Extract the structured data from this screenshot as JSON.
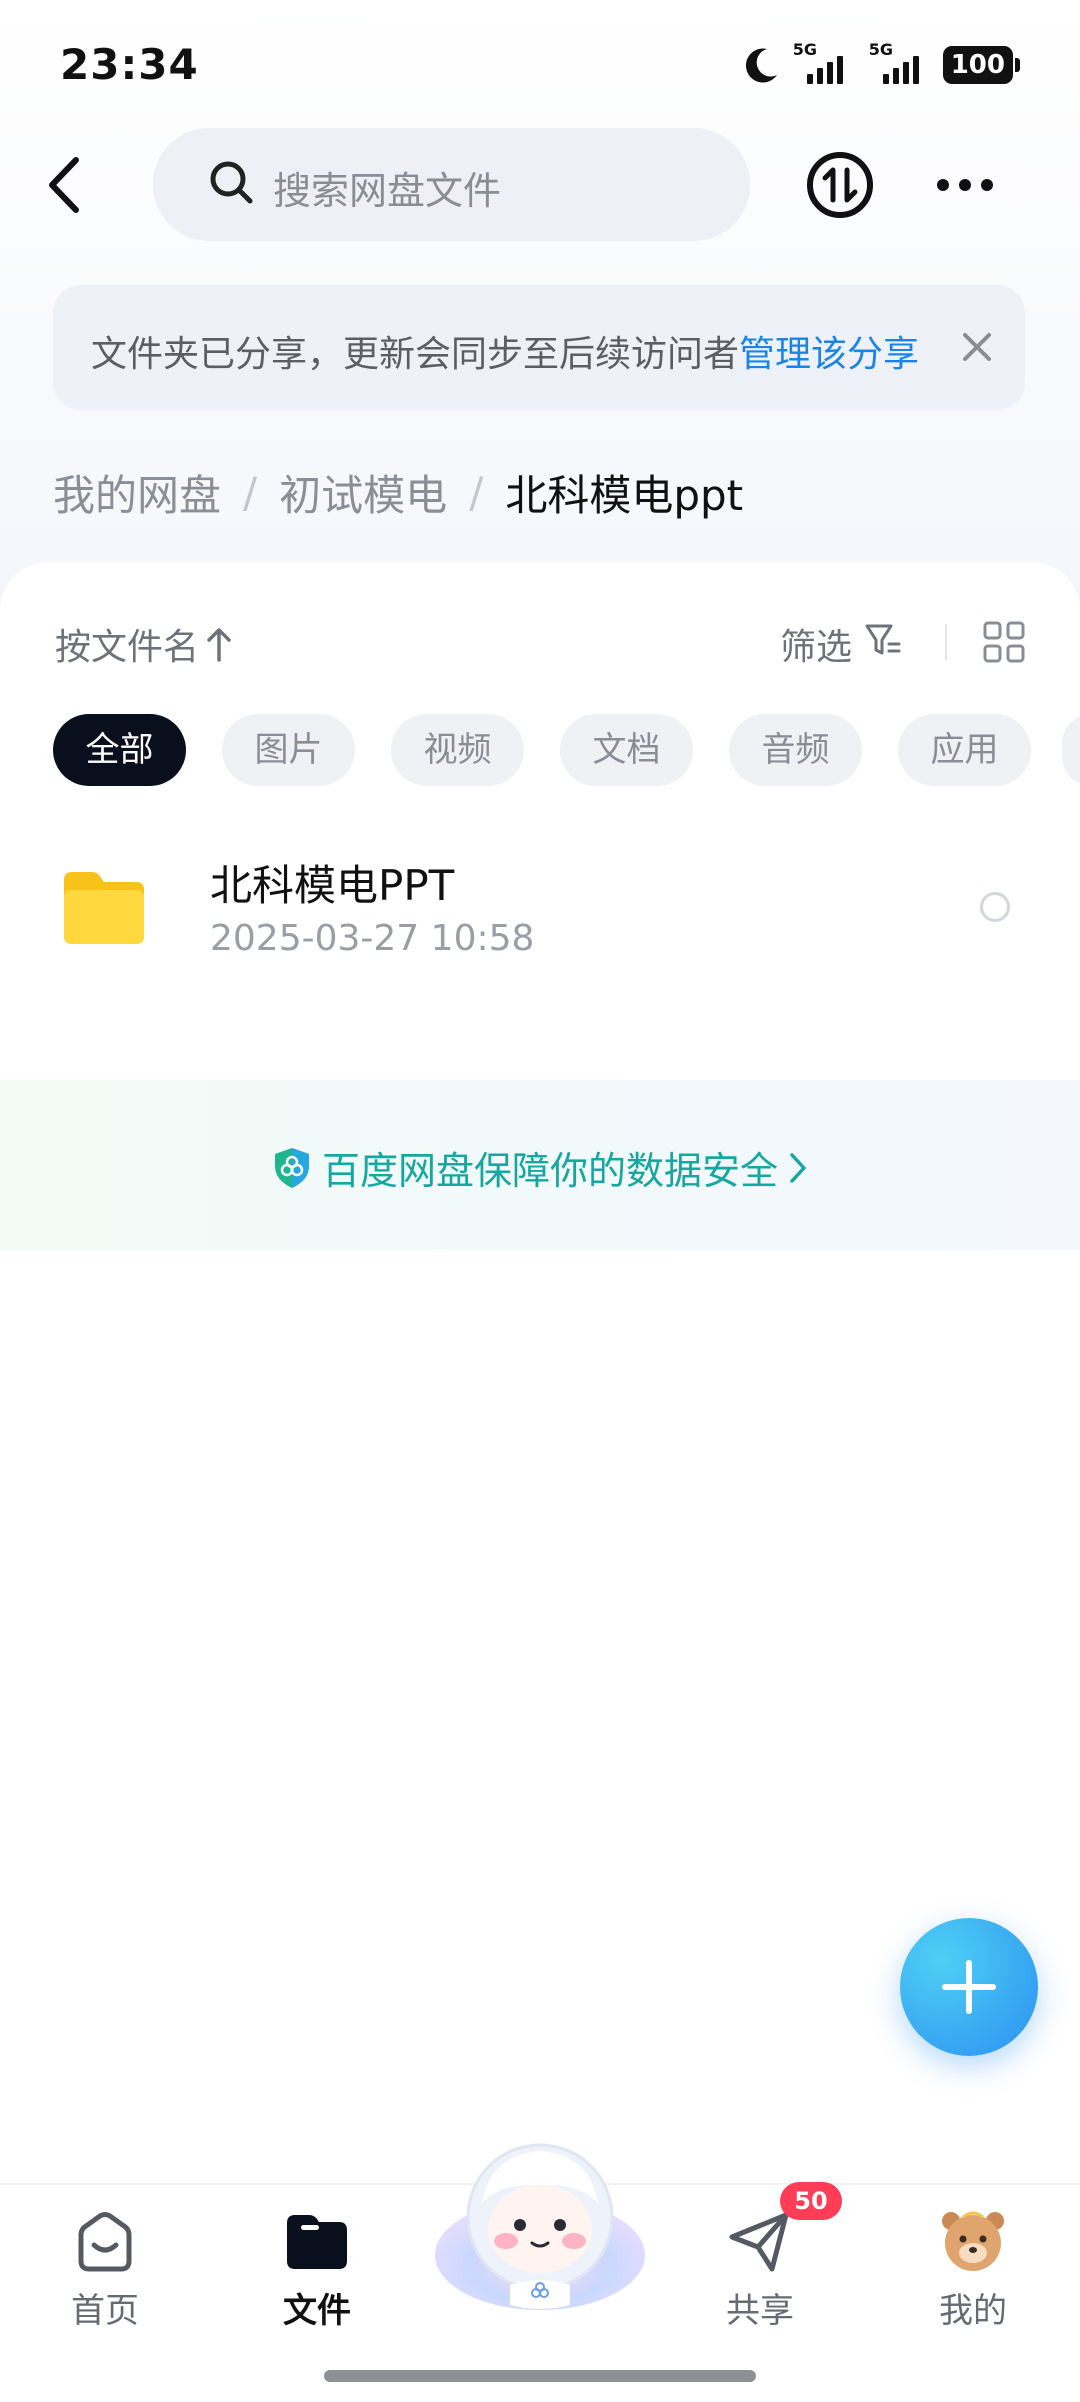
{
  "status_bar": {
    "time": "23:34",
    "network_1": "5G",
    "network_2": "5G",
    "battery": "100",
    "icons": [
      "moon-icon",
      "signal-icon",
      "battery-icon"
    ]
  },
  "header": {
    "search_placeholder": "搜索网盘文件",
    "icons": [
      "back-arrow-icon",
      "search-icon",
      "transfer-icon",
      "more-icon"
    ]
  },
  "notice": {
    "text": "文件夹已分享，更新会同步至后续访问者",
    "link": "管理该分享"
  },
  "breadcrumb": {
    "items": [
      "我的网盘",
      "初试模电"
    ],
    "separator": "/",
    "current": "北科模电ppt"
  },
  "toolbar": {
    "sort_label": "按文件名",
    "filter_label": "筛选"
  },
  "categories": [
    "全部",
    "图片",
    "视频",
    "文档",
    "音频",
    "应用"
  ],
  "files": [
    {
      "name": "北科模电PPT",
      "date": "2025-03-27  10:58",
      "type": "folder"
    }
  ],
  "security": {
    "text": "百度网盘保障你的数据安全"
  },
  "bottom_nav": {
    "items": [
      {
        "label": "首页",
        "icon": "home-icon"
      },
      {
        "label": "文件",
        "icon": "folder-icon"
      },
      {
        "label": "共享",
        "icon": "share-icon"
      },
      {
        "label": "我的",
        "icon": "profile-avatar-icon"
      }
    ],
    "share_badge": "50"
  },
  "colors": {
    "accent": "#1a85e8",
    "security_text": "#17a6a0",
    "active_chip": "#0a0f1d",
    "badge": "#ff3d57",
    "fab": "#2b90f0",
    "folder": "#ffcc22"
  }
}
